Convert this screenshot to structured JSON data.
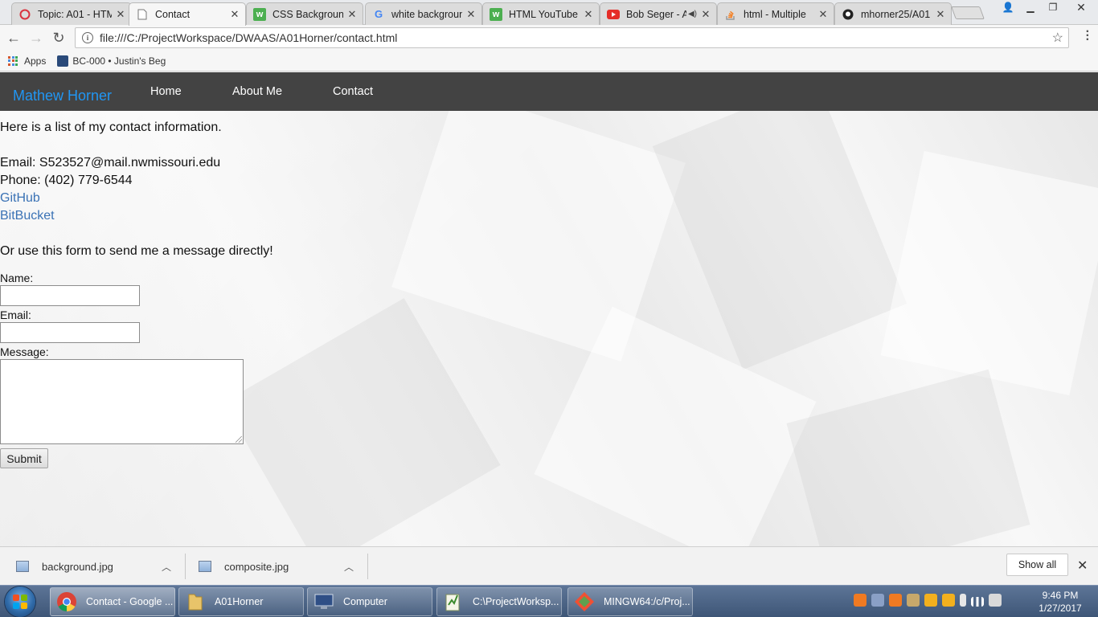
{
  "browser": {
    "tabs": [
      {
        "title": "Topic: A01 - HTM",
        "icon": "opera-icon"
      },
      {
        "title": "Contact",
        "icon": "page-icon",
        "active": true
      },
      {
        "title": "CSS Background",
        "icon": "w3schools-icon"
      },
      {
        "title": "white backgroun",
        "icon": "google-icon"
      },
      {
        "title": "HTML YouTube",
        "icon": "w3schools-icon"
      },
      {
        "title": "Bob Seger - A",
        "icon": "youtube-icon",
        "audio": true
      },
      {
        "title": "html - Multiple",
        "icon": "stackoverflow-icon"
      },
      {
        "title": "mhorner25/A01",
        "icon": "github-icon"
      }
    ],
    "url": "file:///C:/ProjectWorkspace/DWAAS/A01Horner/contact.html",
    "bookmarks": {
      "apps_label": "Apps",
      "item1_label": "BC-000 • Justin's Beg"
    }
  },
  "site": {
    "brand": "Mathew Horner",
    "nav": {
      "home": "Home",
      "about": "About Me",
      "contact": "Contact"
    },
    "intro": "Here is a list of my contact information.",
    "email_line": "Email: S523527@mail.nwmissouri.edu",
    "phone_line": "Phone: (402) 779-6544",
    "github_link": "GitHub",
    "bitbucket_link": "BitBucket",
    "form_intro": "Or use this form to send me a message directly!",
    "form": {
      "name_label": "Name:",
      "name_value": "",
      "email_label": "Email:",
      "email_value": "",
      "message_label": "Message:",
      "message_value": "",
      "submit_label": "Submit"
    }
  },
  "downloads": {
    "items": [
      "background.jpg",
      "composite.jpg"
    ],
    "show_all": "Show all"
  },
  "taskbar": {
    "items": [
      {
        "label": "Contact - Google ...",
        "icon": "chrome-icon",
        "active": true
      },
      {
        "label": "A01Horner",
        "icon": "folder-icon"
      },
      {
        "label": "Computer",
        "icon": "computer-icon"
      },
      {
        "label": "C:\\ProjectWorksp...",
        "icon": "notepad-icon"
      },
      {
        "label": "MINGW64:/c/Proj...",
        "icon": "git-bash-icon"
      }
    ],
    "time": "9:46 PM",
    "date": "1/27/2017"
  },
  "colors": {
    "brand": "#2196f3",
    "navbar": "#434343",
    "link": "#3a72b5"
  }
}
